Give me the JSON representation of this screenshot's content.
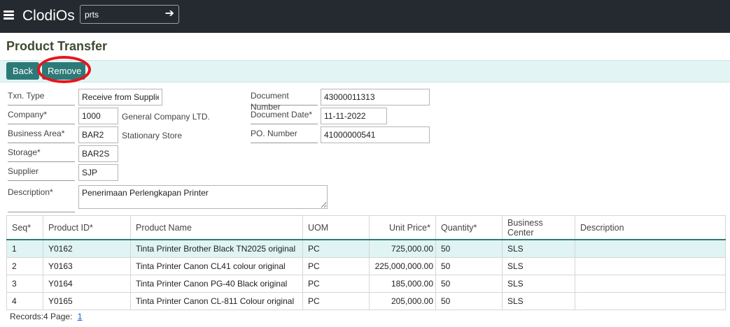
{
  "app": {
    "name": "ClodiOs"
  },
  "nav_search": {
    "value": "prts"
  },
  "page_title": "Product Transfer",
  "toolbar": {
    "back_label": "Back",
    "remove_label": "Remove"
  },
  "form": {
    "txn_type": {
      "label": "Txn. Type",
      "value": "Receive from Supplier"
    },
    "company": {
      "label": "Company*",
      "value": "1000",
      "description": "General Company LTD."
    },
    "business_area": {
      "label": "Business Area*",
      "value": "BAR2",
      "description": "Stationary Store"
    },
    "storage": {
      "label": "Storage*",
      "value": "BAR2S"
    },
    "supplier": {
      "label": "Supplier",
      "value": "SJP"
    },
    "description": {
      "label": "Description*",
      "value": "Penerimaan Perlengkapan Printer"
    },
    "document_number": {
      "label": "Document Number",
      "value": "43000011313"
    },
    "document_date": {
      "label": "Document Date*",
      "value": "11-11-2022"
    },
    "po_number": {
      "label": "PO. Number",
      "value": "41000000541"
    }
  },
  "table": {
    "columns": [
      "Seq*",
      "Product ID*",
      "Product Name",
      "UOM",
      "Unit Price*",
      "Quantity*",
      "Business Center",
      "Description"
    ],
    "rows": [
      [
        "1",
        "Y0162",
        "Tinta Printer Brother Black TN2025 original",
        "PC",
        "725,000.00",
        "50",
        "SLS",
        ""
      ],
      [
        "2",
        "Y0163",
        "Tinta Printer Canon CL41 colour original",
        "PC",
        "225,000,000.00",
        "50",
        "SLS",
        ""
      ],
      [
        "3",
        "Y0164",
        "Tinta Printer Canon PG-40 Black original",
        "PC",
        "185,000.00",
        "50",
        "SLS",
        ""
      ],
      [
        "4",
        "Y0165",
        "Tinta Printer Canon CL-811 Colour original",
        "PC",
        "205,000.00",
        "50",
        "SLS",
        ""
      ]
    ]
  },
  "footer": {
    "records_label": "Records:4",
    "page_label": "Page:",
    "page_link": "1"
  },
  "colors": {
    "topbar": "#252a30",
    "accent": "#2c7a78",
    "highlight": "#e8141b",
    "selected_row": "#dff4f3"
  },
  "icons": {
    "menu": "hamburger-menu-icon",
    "go": "arrow-right-icon"
  }
}
